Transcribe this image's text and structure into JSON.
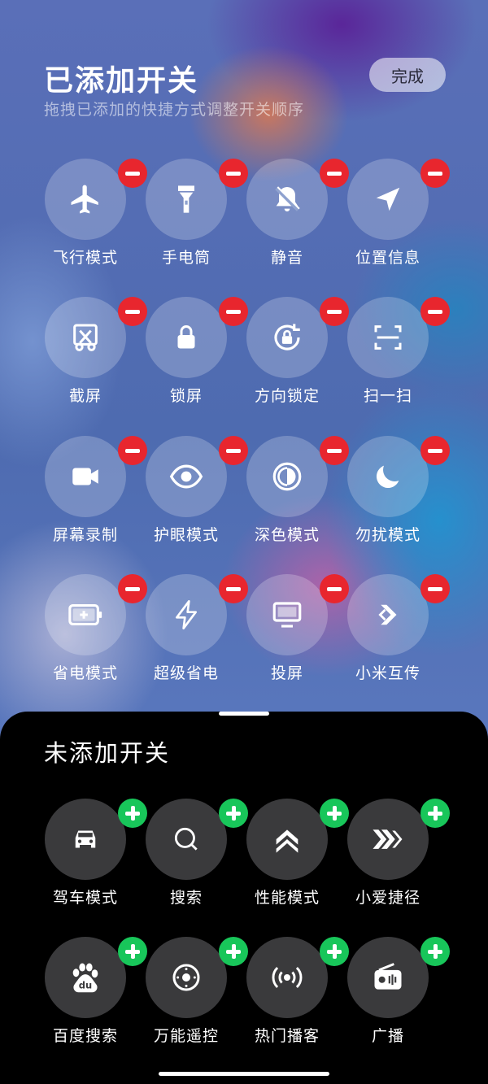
{
  "header": {
    "title": "已添加开关",
    "subtitle": "拖拽已添加的快捷方式调整开关顺序",
    "done_label": "完成"
  },
  "added_toggles": [
    {
      "label": "飞行模式",
      "icon": "airplane-icon"
    },
    {
      "label": "手电筒",
      "icon": "flashlight-icon"
    },
    {
      "label": "静音",
      "icon": "bell-muted-icon"
    },
    {
      "label": "位置信息",
      "icon": "location-arrow-icon"
    },
    {
      "label": "截屏",
      "icon": "screenshot-scissors-icon"
    },
    {
      "label": "锁屏",
      "icon": "lock-icon"
    },
    {
      "label": "方向锁定",
      "icon": "rotation-lock-icon"
    },
    {
      "label": "扫一扫",
      "icon": "scan-icon"
    },
    {
      "label": "屏幕录制",
      "icon": "video-camera-icon"
    },
    {
      "label": "护眼模式",
      "icon": "eye-icon"
    },
    {
      "label": "深色模式",
      "icon": "dark-mode-icon"
    },
    {
      "label": "勿扰模式",
      "icon": "moon-icon"
    },
    {
      "label": "省电模式",
      "icon": "battery-icon"
    },
    {
      "label": "超级省电",
      "icon": "lightning-icon"
    },
    {
      "label": "投屏",
      "icon": "monitor-icon"
    },
    {
      "label": "小米互传",
      "icon": "mi-share-icon"
    }
  ],
  "not_added": {
    "title": "未添加开关",
    "items": [
      {
        "label": "驾车模式",
        "icon": "car-icon"
      },
      {
        "label": "搜索",
        "icon": "search-icon"
      },
      {
        "label": "性能模式",
        "icon": "chevrons-up-icon"
      },
      {
        "label": "小爱捷径",
        "icon": "shortcut-icon"
      },
      {
        "label": "百度搜索",
        "icon": "baidu-icon"
      },
      {
        "label": "万能遥控",
        "icon": "remote-control-icon"
      },
      {
        "label": "热门播客",
        "icon": "podcast-icon"
      },
      {
        "label": "广播",
        "icon": "radio-icon"
      }
    ]
  },
  "colors": {
    "remove_badge": "#e8262e",
    "add_badge": "#18c65a",
    "panel_bg": "#000000"
  }
}
